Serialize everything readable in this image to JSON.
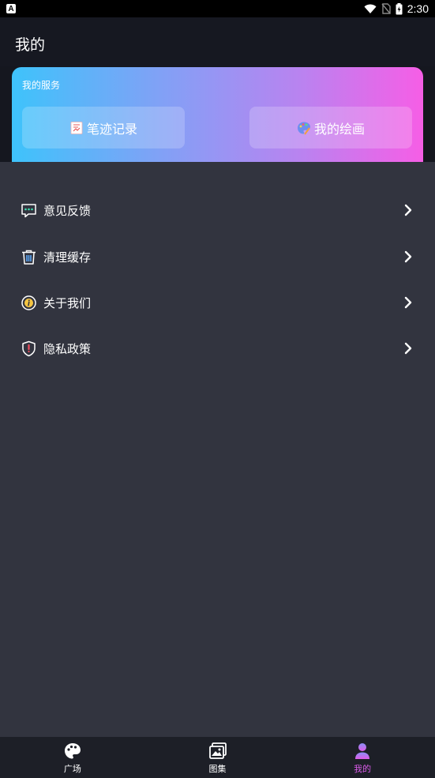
{
  "status_bar": {
    "left_icon_letter": "A",
    "time": "2:30",
    "icons": [
      "wifi-icon",
      "no-sim-icon",
      "battery-icon"
    ]
  },
  "header": {
    "title": "我的"
  },
  "services": {
    "label": "我的服务",
    "buttons": [
      {
        "label": "笔迹记录",
        "icon": "note-icon"
      },
      {
        "label": "我的绘画",
        "icon": "palette-icon"
      }
    ]
  },
  "menu": {
    "items": [
      {
        "label": "意见反馈",
        "icon": "feedback-icon"
      },
      {
        "label": "清理缓存",
        "icon": "trash-icon"
      },
      {
        "label": "关于我们",
        "icon": "info-icon"
      },
      {
        "label": "隐私政策",
        "icon": "shield-icon"
      }
    ]
  },
  "bottom_nav": {
    "items": [
      {
        "label": "广场",
        "icon": "palette-icon",
        "active": false
      },
      {
        "label": "图集",
        "icon": "gallery-icon",
        "active": false
      },
      {
        "label": "我的",
        "icon": "user-icon",
        "active": true
      }
    ]
  },
  "colors": {
    "accent": "#d85be8",
    "gradient_start": "#3ec3fb",
    "gradient_end": "#f65ee6",
    "panel_bg": "#32343f"
  }
}
